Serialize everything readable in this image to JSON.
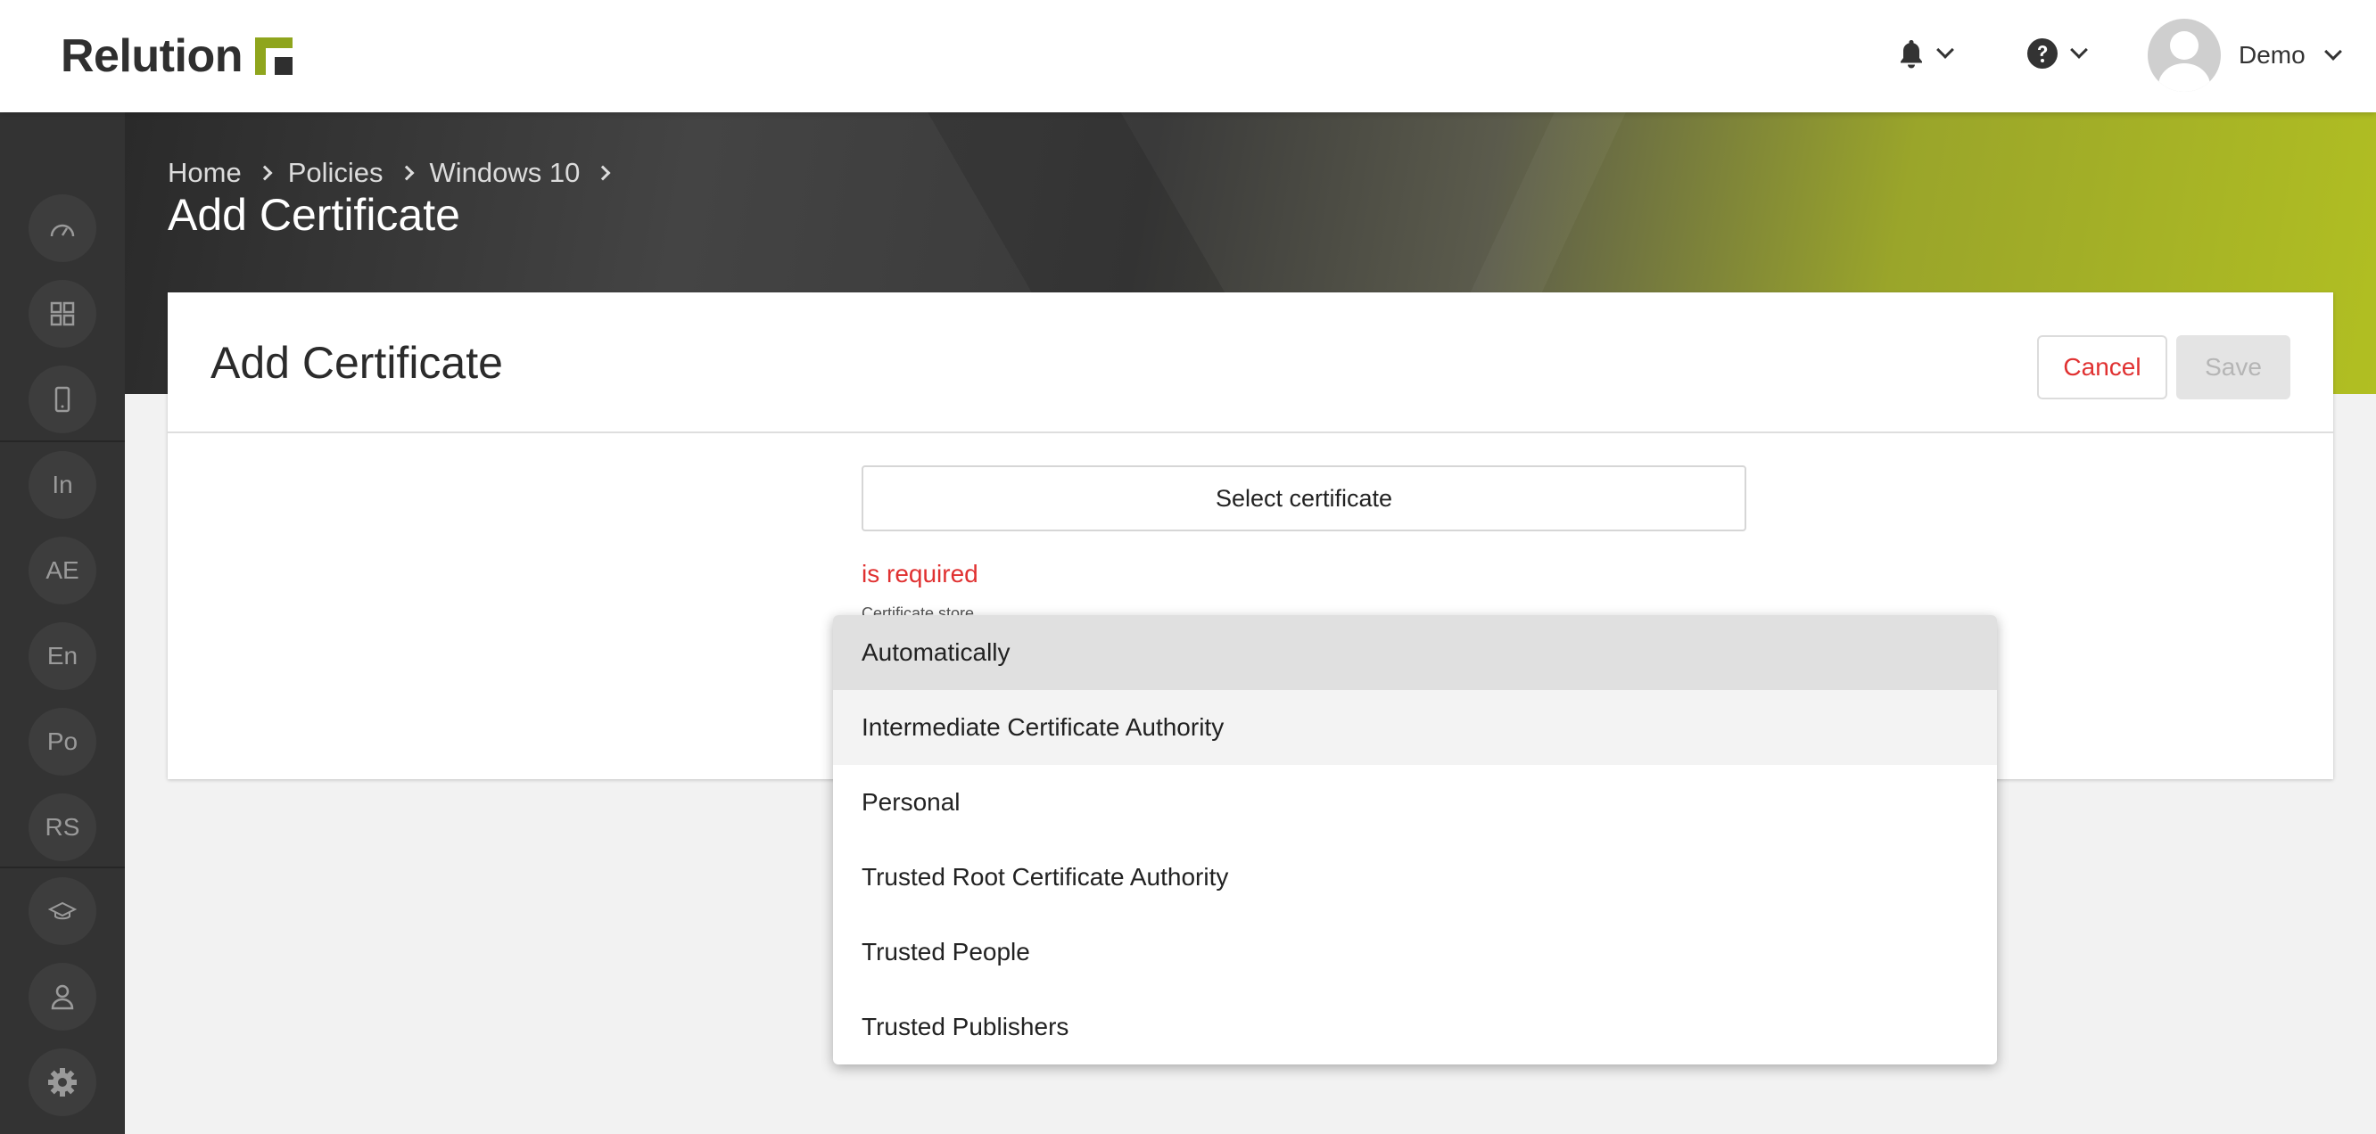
{
  "header": {
    "logo_text": "Relution",
    "user_name": "Demo"
  },
  "sidebar": {
    "items": [
      {
        "icon": "dashboard-icon"
      },
      {
        "icon": "apps-grid-icon"
      },
      {
        "icon": "device-icon"
      },
      {
        "label": "In"
      },
      {
        "label": "AE"
      },
      {
        "label": "En"
      },
      {
        "label": "Po"
      },
      {
        "label": "RS"
      },
      {
        "icon": "education-icon"
      },
      {
        "icon": "user-icon"
      },
      {
        "icon": "gear-icon"
      }
    ]
  },
  "breadcrumb": [
    "Home",
    "Policies",
    "Windows 10"
  ],
  "page_title": "Add Certificate",
  "card": {
    "title": "Add Certificate",
    "cancel_label": "Cancel",
    "save_label": "Save",
    "select_certificate_label": "Select certificate",
    "error_text": "is required",
    "store_label": "Certificate store"
  },
  "dropdown": {
    "options": [
      "Automatically",
      "Intermediate Certificate Authority",
      "Personal",
      "Trusted Root Certificate Authority",
      "Trusted People",
      "Trusted Publishers"
    ],
    "selected": "Automatically"
  },
  "colors": {
    "accent": "#8fa51d",
    "error": "#e03131",
    "sidebar": "#333333"
  }
}
